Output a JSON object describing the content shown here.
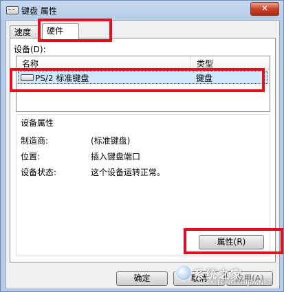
{
  "window": {
    "title": "键盘 属性",
    "close": "✕"
  },
  "tabs": [
    {
      "label": "速度"
    },
    {
      "label": "硬件"
    }
  ],
  "devices": {
    "label": "设备(D):",
    "columns": {
      "name": "名称",
      "type": "类型"
    },
    "rows": [
      {
        "name": "PS/2 标准键盘",
        "type": "键盘"
      }
    ]
  },
  "properties": {
    "title": "设备属性",
    "rows": [
      {
        "label": "制造商:",
        "value": "(标准键盘)"
      },
      {
        "label": "位置:",
        "value": "插入键盘端口"
      },
      {
        "label": "设备状态:",
        "value": "这个设备运转正常。"
      }
    ],
    "button": "属性(R)"
  },
  "footer": {
    "ok": "确定",
    "cancel": "取消",
    "apply": "应用(A)"
  },
  "watermark": {
    "text": "系统之家",
    "url": "XITONGZHIJIA.NET"
  },
  "colors": {
    "highlight": "#e0111b",
    "selected_row": "#cde8ff",
    "titlebar": "#b9d1ea"
  }
}
